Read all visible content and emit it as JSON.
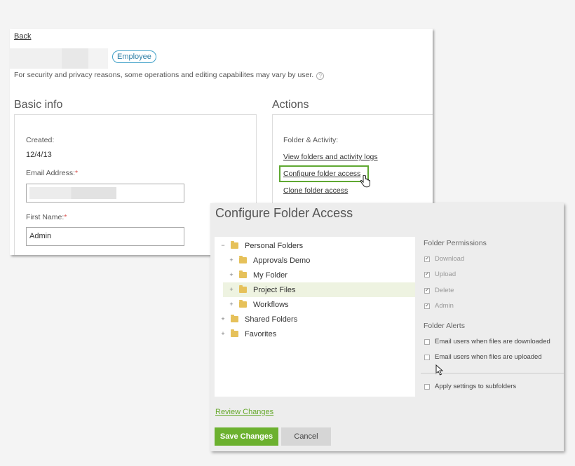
{
  "profile": {
    "back_label": "Back",
    "role_badge": "Employee",
    "security_note": "For security and privacy reasons, some operations and editing capabilites may vary by user.",
    "help_glyph": "?",
    "basic_info": {
      "title": "Basic info",
      "created_label": "Created:",
      "created_value": "12/4/13",
      "email_label": "Email Address:",
      "first_name_label": "First Name:",
      "first_name_value": "Admin",
      "required_mark": "*"
    },
    "actions": {
      "title": "Actions",
      "folder_activity_label": "Folder & Activity:",
      "links": [
        "View folders and activity logs",
        "Configure folder access",
        "Clone folder access"
      ]
    }
  },
  "modal": {
    "title": "Configure Folder Access",
    "tree": [
      {
        "label": "Personal Folders",
        "toggle": "−",
        "level": 0
      },
      {
        "label": "Approvals Demo",
        "toggle": "+",
        "level": 1
      },
      {
        "label": "My Folder",
        "toggle": "+",
        "level": 1
      },
      {
        "label": "Project Files",
        "toggle": "+",
        "level": 1,
        "selected": true
      },
      {
        "label": "Workflows",
        "toggle": "+",
        "level": 1
      },
      {
        "label": "Shared Folders",
        "toggle": "+",
        "level": 0
      },
      {
        "label": "Favorites",
        "toggle": "+",
        "level": 0
      }
    ],
    "permissions": {
      "title": "Folder Permissions",
      "items": [
        "Download",
        "Upload",
        "Delete",
        "Admin"
      ],
      "check_glyph": "✔"
    },
    "alerts": {
      "title": "Folder Alerts",
      "items": [
        "Email users when files are downloaded",
        "Email users when files are uploaded"
      ]
    },
    "subfolders_label": "Apply settings to subfolders",
    "review_label": "Review Changes",
    "save_label": "Save Changes",
    "cancel_label": "Cancel"
  },
  "colors": {
    "accent_green": "#6cb12f",
    "badge_blue": "#3fa0c8",
    "highlight_green": "#5fa832",
    "folder_yellow": "#e6c15a"
  }
}
